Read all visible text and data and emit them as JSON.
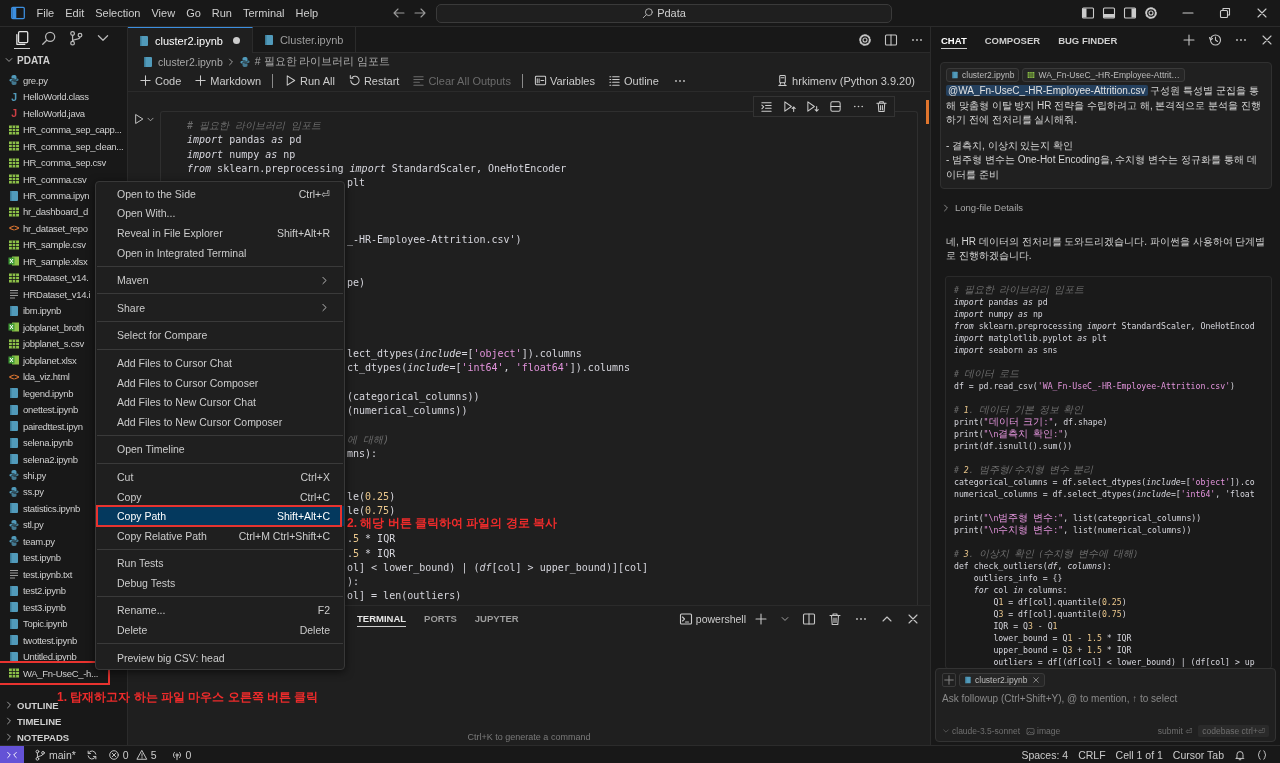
{
  "title_bar": {
    "menus": [
      "File",
      "Edit",
      "Selection",
      "View",
      "Go",
      "Run",
      "Terminal",
      "Help"
    ],
    "search": "Pdata"
  },
  "activity_bar": [
    {
      "kind": "files",
      "selected": true
    },
    {
      "kind": "search",
      "selected": false
    },
    {
      "kind": "source-control",
      "selected": false
    },
    {
      "kind": "more",
      "selected": false
    }
  ],
  "explorer": {
    "title": "PDATA",
    "files": [
      {
        "name": "gre.py",
        "kind": "py"
      },
      {
        "name": "HelloWorld.class",
        "kind": "class",
        "glyph": "J"
      },
      {
        "name": "HelloWorld.java",
        "kind": "java",
        "glyph": "J"
      },
      {
        "name": "HR_comma_sep_capp...",
        "kind": "csv"
      },
      {
        "name": "HR_comma_sep_clean...",
        "kind": "csv"
      },
      {
        "name": "HR_comma_sep.csv",
        "kind": "csv"
      },
      {
        "name": "HR_comma.csv",
        "kind": "csv"
      },
      {
        "name": "HR_comma.ipyn",
        "kind": "ipynb"
      },
      {
        "name": "hr_dashboard_d",
        "kind": "csv"
      },
      {
        "name": "hr_dataset_repo",
        "kind": "html",
        "glyph": "<>"
      },
      {
        "name": "HR_sample.csv",
        "kind": "csv"
      },
      {
        "name": "HR_sample.xlsx",
        "kind": "xlsx"
      },
      {
        "name": "HRDataset_v14.",
        "kind": "csv"
      },
      {
        "name": "HRDataset_v14.i",
        "kind": "txt"
      },
      {
        "name": "ibm.ipynb",
        "kind": "ipynb"
      },
      {
        "name": "jobplanet_broth",
        "kind": "xlsx"
      },
      {
        "name": "jobplanet_s.csv",
        "kind": "csv"
      },
      {
        "name": "jobplanet.xlsx",
        "kind": "xlsx"
      },
      {
        "name": "lda_viz.html",
        "kind": "html",
        "glyph": "<>"
      },
      {
        "name": "legend.ipynb",
        "kind": "ipynb"
      },
      {
        "name": "onettest.ipynb",
        "kind": "ipynb"
      },
      {
        "name": "pairedttest.ipyn",
        "kind": "ipynb"
      },
      {
        "name": "selena.ipynb",
        "kind": "ipynb"
      },
      {
        "name": "selena2.ipynb",
        "kind": "ipynb"
      },
      {
        "name": "shi.py",
        "kind": "py"
      },
      {
        "name": "ss.py",
        "kind": "py"
      },
      {
        "name": "statistics.ipynb",
        "kind": "ipynb"
      },
      {
        "name": "stl.py",
        "kind": "py"
      },
      {
        "name": "team.py",
        "kind": "py"
      },
      {
        "name": "test.ipynb",
        "kind": "ipynb"
      },
      {
        "name": "test.ipynb.txt",
        "kind": "txt"
      },
      {
        "name": "test2.ipynb",
        "kind": "ipynb"
      },
      {
        "name": "test3.ipynb",
        "kind": "ipynb"
      },
      {
        "name": "Topic.ipynb",
        "kind": "ipynb"
      },
      {
        "name": "twottest.ipynb",
        "kind": "ipynb"
      },
      {
        "name": "Untitled.ipynb",
        "kind": "ipynb"
      },
      {
        "name": "WA_Fn-UseC_-h...",
        "kind": "csv",
        "annotated": true
      }
    ],
    "sections": [
      "OUTLINE",
      "TIMELINE",
      "NOTEPADS"
    ]
  },
  "editor": {
    "tabs": [
      {
        "label": "cluster2.ipynb",
        "selected": true,
        "modified": true
      },
      {
        "label": "Cluster.ipynb",
        "selected": false,
        "modified": false
      }
    ],
    "breadcrumb": [
      "cluster2.ipynb",
      "# 필요한 라이브러리 임포트"
    ],
    "toolbar": [
      {
        "kind": "add",
        "label": "Code"
      },
      {
        "kind": "add",
        "label": "Markdown"
      },
      {
        "kind": "divider"
      },
      {
        "kind": "run",
        "label": "Run All"
      },
      {
        "kind": "restart",
        "label": "Restart"
      },
      {
        "kind": "clear",
        "label": "Clear All Outputs",
        "disabled": true
      },
      {
        "kind": "divider"
      },
      {
        "kind": "variables",
        "label": "Variables"
      },
      {
        "kind": "outline",
        "label": "Outline"
      },
      {
        "kind": "more"
      }
    ],
    "kernel": "hrkimenv (Python 3.9.20)",
    "code": [
      {
        "kind": "comment",
        "text": "# 필요한 라이브러리 임포트"
      },
      {
        "kind": "code",
        "text": "*import* pandas *as* pd"
      },
      {
        "kind": "code",
        "text": "*import* numpy *as* np"
      },
      {
        "kind": "code",
        "text": "*from* sklearn.preprocessing *import* StandardScaler, OneHotEncoder"
      },
      {
        "kind": "clipped",
        "text": "plt"
      },
      {
        "kind": "blank"
      },
      {
        "kind": "blank"
      },
      {
        "kind": "blank"
      },
      {
        "kind": "clipped",
        "text": "_-HR-Employee-Attrition.csv')"
      },
      {
        "kind": "blank"
      },
      {
        "kind": "blank"
      },
      {
        "kind": "clipped",
        "text": "pe)"
      },
      {
        "kind": "blank"
      },
      {
        "kind": "blank"
      },
      {
        "kind": "blank"
      },
      {
        "kind": "blank"
      },
      {
        "kind": "clipped",
        "text": "lect_dtypes(*include*=['object']).columns"
      },
      {
        "kind": "clipped",
        "text": "ct_dtypes(*include*=['int64', 'float64']).columns"
      },
      {
        "kind": "blank"
      },
      {
        "kind": "clipped",
        "text": "(categorical_columns))"
      },
      {
        "kind": "clipped",
        "text": "(numerical_columns))"
      },
      {
        "kind": "blank"
      },
      {
        "kind": "clipped-comment",
        "text": "에 대해)"
      },
      {
        "kind": "clipped",
        "text": "mns):"
      },
      {
        "kind": "blank"
      },
      {
        "kind": "blank"
      },
      {
        "kind": "clipped",
        "text": "le(0.25)"
      },
      {
        "kind": "clipped",
        "text": "le(0.75)"
      },
      {
        "kind": "blank"
      },
      {
        "kind": "clipped",
        "text": ".5 * IQR"
      },
      {
        "kind": "clipped",
        "text": ".5 * IQR"
      },
      {
        "kind": "clipped",
        "text": "ol] < lower_bound) | (*df*[col] > upper_bound)][col]"
      },
      {
        "kind": "clipped",
        "text": "):"
      },
      {
        "kind": "clipped",
        "text": "ol] = len(outliers)"
      }
    ]
  },
  "context_menu": {
    "groups": [
      [
        {
          "label": "Open to the Side",
          "shortcut": "Ctrl+⏎",
          "selected": false
        },
        {
          "label": "Open With...",
          "selected": false
        },
        {
          "label": "Reveal in File Explorer",
          "shortcut": "Shift+Alt+R",
          "selected": false
        },
        {
          "label": "Open in Integrated Terminal",
          "selected": false
        }
      ],
      [
        {
          "label": "Maven",
          "submenu": true,
          "selected": false
        }
      ],
      [
        {
          "label": "Share",
          "submenu": true,
          "selected": false
        }
      ],
      [
        {
          "label": "Select for Compare",
          "selected": false
        }
      ],
      [
        {
          "label": "Add Files to Cursor Chat",
          "selected": false
        },
        {
          "label": "Add Files to Cursor Composer",
          "selected": false
        },
        {
          "label": "Add Files to New Cursor Chat",
          "selected": false
        },
        {
          "label": "Add Files to New Cursor Composer",
          "selected": false
        }
      ],
      [
        {
          "label": "Open Timeline",
          "selected": false
        }
      ],
      [
        {
          "label": "Cut",
          "shortcut": "Ctrl+X",
          "selected": false
        },
        {
          "label": "Copy",
          "shortcut": "Ctrl+C",
          "selected": false
        },
        {
          "label": "Copy Path",
          "shortcut": "Shift+Alt+C",
          "selected": true,
          "annotated": true
        },
        {
          "label": "Copy Relative Path",
          "shortcut": "Ctrl+M Ctrl+Shift+C",
          "selected": false
        }
      ],
      [
        {
          "label": "Run Tests",
          "selected": false
        },
        {
          "label": "Debug Tests",
          "selected": false
        }
      ],
      [
        {
          "label": "Rename...",
          "shortcut": "F2",
          "selected": false
        },
        {
          "label": "Delete",
          "shortcut": "Delete",
          "selected": false
        }
      ],
      [
        {
          "label": "Preview big CSV: head",
          "selected": false
        }
      ]
    ]
  },
  "panel": {
    "tabs": [
      {
        "label": "TERMINAL",
        "selected": true
      },
      {
        "label": "PORTS",
        "selected": false
      },
      {
        "label": "JUPYTER",
        "selected": false
      }
    ],
    "shell": "powershell",
    "hint": "Ctrl+K to generate a command"
  },
  "annotations": [
    {
      "kind": "file-note",
      "text": "1. 탑재하고자 하는 파일 마우스 오른쪽 버튼 클릭"
    },
    {
      "kind": "menu-note",
      "text": "2. 해당 버튼 클릭하여 파일의 경로 복사"
    }
  ],
  "chat": {
    "tabs": [
      {
        "label": "CHAT",
        "selected": true
      },
      {
        "label": "COMPOSER",
        "selected": false
      },
      {
        "label": "BUG FINDER",
        "selected": false
      }
    ],
    "message": {
      "chips": [
        {
          "label": "cluster2.ipynb",
          "kind": "ipynb"
        },
        {
          "label": "WA_Fn-UseC_-HR-Employee-Attrit…",
          "kind": "csv"
        }
      ],
      "mention": "@WA_Fn-UseC_-HR-Employee-Attrition.csv",
      "text": " 구성원 특성별 군집을 통해 맞춤형 이탈 방지 HR 전략을 수립하려고 해, 본격적으로 분석을 진행하기 전에 전처리를 실시해줘.",
      "bullets": [
        "- 결측치, 이상치 있는지 확인",
        "- 범주형 변수는 One-Hot Encoding을, 수치형 변수는 정규화를 통해 데이터를 준비"
      ]
    },
    "details": "Long-file Details",
    "reply": "네, HR 데이터의 전처리를 도와드리겠습니다. 파이썬을 사용하여 단계별로 진행하겠습니다.",
    "code": [
      {
        "kind": "comment",
        "text": "# 필요한 라이브러리 임포트"
      },
      {
        "kind": "code",
        "text": "*import* pandas *as* pd"
      },
      {
        "kind": "code",
        "text": "*import* numpy *as* np"
      },
      {
        "kind": "code",
        "text": "*from* sklearn.preprocessing *import* StandardScaler, OneHotEncod"
      },
      {
        "kind": "code",
        "text": "*import* matplotlib.pyplot *as* plt"
      },
      {
        "kind": "code",
        "text": "*import* seaborn *as* sns"
      },
      {
        "kind": "blank"
      },
      {
        "kind": "comment",
        "text": "# 데이터 로드"
      },
      {
        "kind": "code",
        "text": "df = pd.read_csv('WA_Fn-UseC_-HR-Employee-Attrition.csv')"
      },
      {
        "kind": "blank"
      },
      {
        "kind": "comment",
        "text": "# 1. 데이터 기본 정보 확인"
      },
      {
        "kind": "code",
        "text": "print(\"데이터 크기:\", df.shape)"
      },
      {
        "kind": "code",
        "text": "print(\"\\n결측치 확인:\")"
      },
      {
        "kind": "code",
        "text": "print(df.isnull().sum())"
      },
      {
        "kind": "blank"
      },
      {
        "kind": "comment",
        "text": "# 2. 범주형/수치형 변수 분리"
      },
      {
        "kind": "code",
        "text": "categorical_columns = df.select_dtypes(*include*=['object']).co"
      },
      {
        "kind": "code",
        "text": "numerical_columns = df.select_dtypes(*include*=['int64', 'float"
      },
      {
        "kind": "blank"
      },
      {
        "kind": "code",
        "text": "print(\"\\n범주형 변수:\", list(categorical_columns))"
      },
      {
        "kind": "code",
        "text": "print(\"\\n수치형 변수:\", list(numerical_columns))"
      },
      {
        "kind": "blank"
      },
      {
        "kind": "comment",
        "text": "# 3. 이상치 확인 (수치형 변수에 대해)"
      },
      {
        "kind": "code",
        "text": "def check_outliers(*df*, *columns*):"
      },
      {
        "kind": "code",
        "text": "    outliers_info = {}"
      },
      {
        "kind": "code",
        "text": "    *for* col *in* columns:"
      },
      {
        "kind": "code",
        "text": "        Q1 = df[col].quantile(0.25)"
      },
      {
        "kind": "code",
        "text": "        Q3 = df[col].quantile(0.75)"
      },
      {
        "kind": "code",
        "text": "        IQR = Q3 - Q1"
      },
      {
        "kind": "code",
        "text": "        lower_bound = Q1 - 1.5 * IQR"
      },
      {
        "kind": "code",
        "text": "        upper_bound = Q3 + 1.5 * IQR"
      },
      {
        "kind": "code",
        "text": "        outliers = df[(df[col] < lower_bound) | (df[col] > up"
      }
    ],
    "input": {
      "chip": "cluster2.ipynb",
      "placeholder": "Ask followup (Ctrl+Shift+Y), @ to mention, ↑ to select",
      "model": "claude-3.5-sonnet",
      "image": "image",
      "submit": "submit ⏎",
      "codebase": "codebase ctrl+⏎"
    }
  },
  "status_bar": {
    "branch": "main*",
    "errors": "0",
    "warnings": "5",
    "ports": "0",
    "items": [
      "Spaces: 4",
      "CRLF",
      "Cell 1 of 1",
      "Cursor Tab"
    ]
  }
}
